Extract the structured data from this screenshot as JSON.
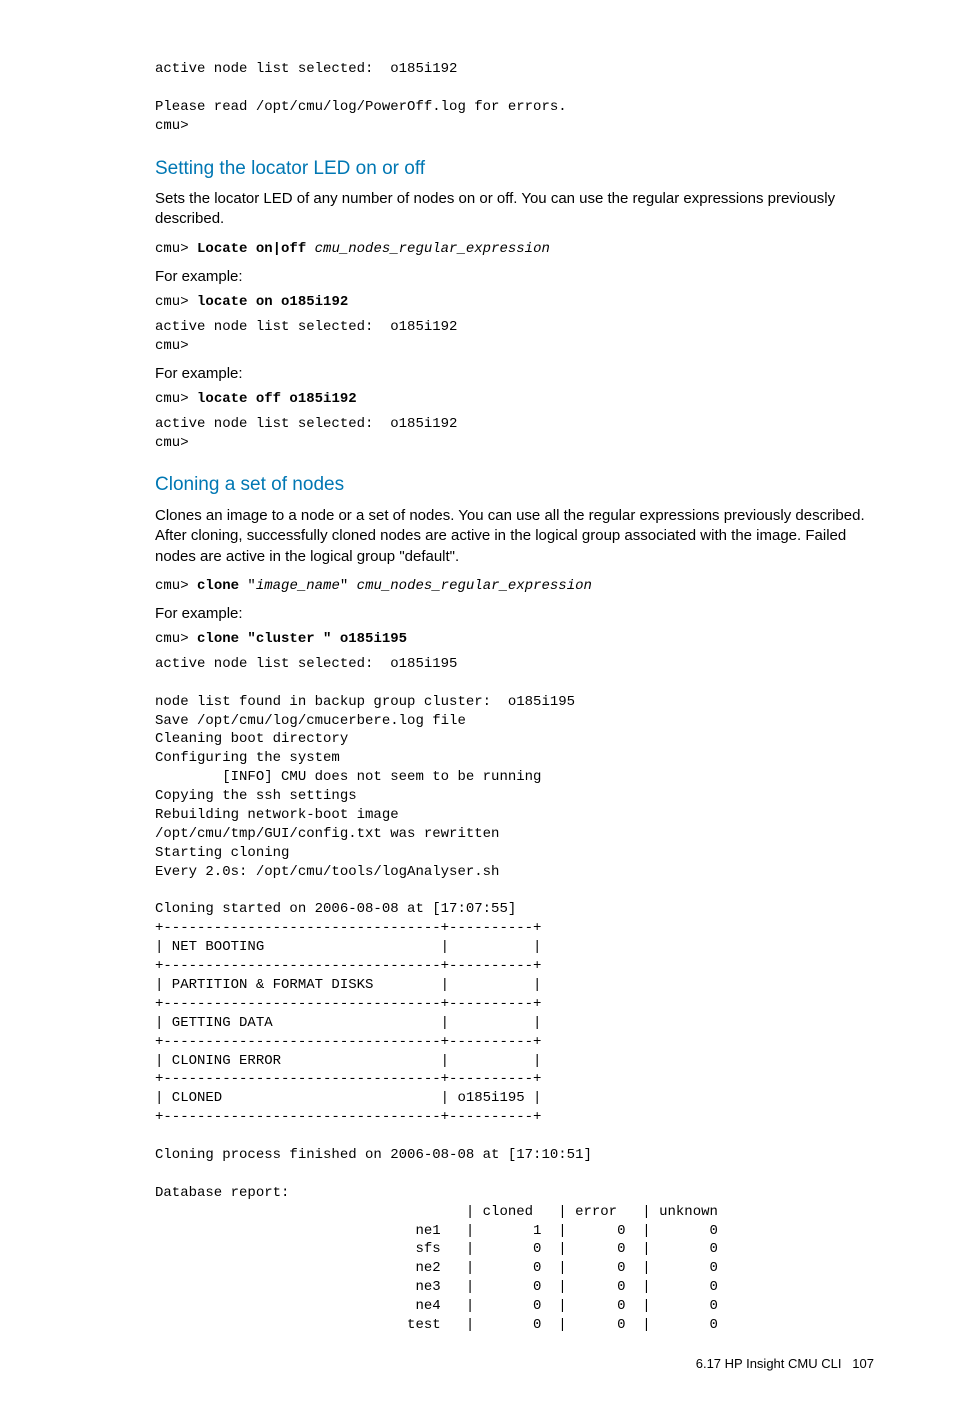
{
  "preamble": {
    "line1": "active node list selected:  o185i192",
    "line2": "",
    "line3": "Please read /opt/cmu/log/PowerOff.log for errors.",
    "line4": "cmu>"
  },
  "section1": {
    "heading": "Setting the locator LED on or off",
    "para": "Sets the locator LED of any number of nodes on or off. You can use the regular expressions previously described.",
    "syntax_prompt": "cmu> ",
    "syntax_cmd": "Locate on|off",
    "syntax_arg": " cmu_nodes_regular_expression",
    "for_example1": "For example:",
    "ex1_prompt": "cmu> ",
    "ex1_cmd": "locate on o185i192",
    "ex1_out1": "active node list selected:  o185i192",
    "ex1_out2": "cmu>",
    "for_example2": "For example:",
    "ex2_prompt": "cmu> ",
    "ex2_cmd": "locate off o185i192",
    "ex2_out1": "active node list selected:  o185i192",
    "ex2_out2": "cmu>"
  },
  "section2": {
    "heading": "Cloning a set of nodes",
    "para": "Clones an image to a node or a set of nodes. You can use all the regular expressions previously described. After cloning, successfully cloned nodes are active in the logical group associated with the image. Failed nodes are active in the logical group \"default\".",
    "syntax_prompt": "cmu> ",
    "syntax_cmd": "clone",
    "syntax_arg1": " \"",
    "syntax_arg2": "image_name",
    "syntax_arg3": "\" ",
    "syntax_arg4": "cmu_nodes_regular_expression",
    "for_example": "For example:",
    "ex_prompt": "cmu> ",
    "ex_cmd": "clone \"cluster \" o185i195",
    "output": "active node list selected:  o185i195\n\nnode list found in backup group cluster:  o185i195\nSave /opt/cmu/log/cmucerbere.log file\nCleaning boot directory\nConfiguring the system\n        [INFO] CMU does not seem to be running\nCopying the ssh settings\nRebuilding network-boot image\n/opt/cmu/tmp/GUI/config.txt was rewritten\nStarting cloning\nEvery 2.0s: /opt/cmu/tools/logAnalyser.sh\n\nCloning started on 2006-08-08 at [17:07:55]\n+---------------------------------+----------+\n| NET BOOTING                     |          |\n+---------------------------------+----------+\n| PARTITION & FORMAT DISKS        |          |\n+---------------------------------+----------+\n| GETTING DATA                    |          |\n+---------------------------------+----------+\n| CLONING ERROR                   |          |\n+---------------------------------+----------+\n| CLONED                          | o185i195 |\n+---------------------------------+----------+\n\nCloning process finished on 2006-08-08 at [17:10:51]\n\nDatabase report:\n                                     | cloned   | error   | unknown\n                               ne1   |       1  |      0  |       0\n                               sfs   |       0  |      0  |       0\n                               ne2   |       0  |      0  |       0\n                               ne3   |       0  |      0  |       0\n                               ne4   |       0  |      0  |       0\n                              test   |       0  |      0  |       0"
  },
  "footer": {
    "section": "6.17 HP Insight CMU CLI",
    "page": "107"
  }
}
